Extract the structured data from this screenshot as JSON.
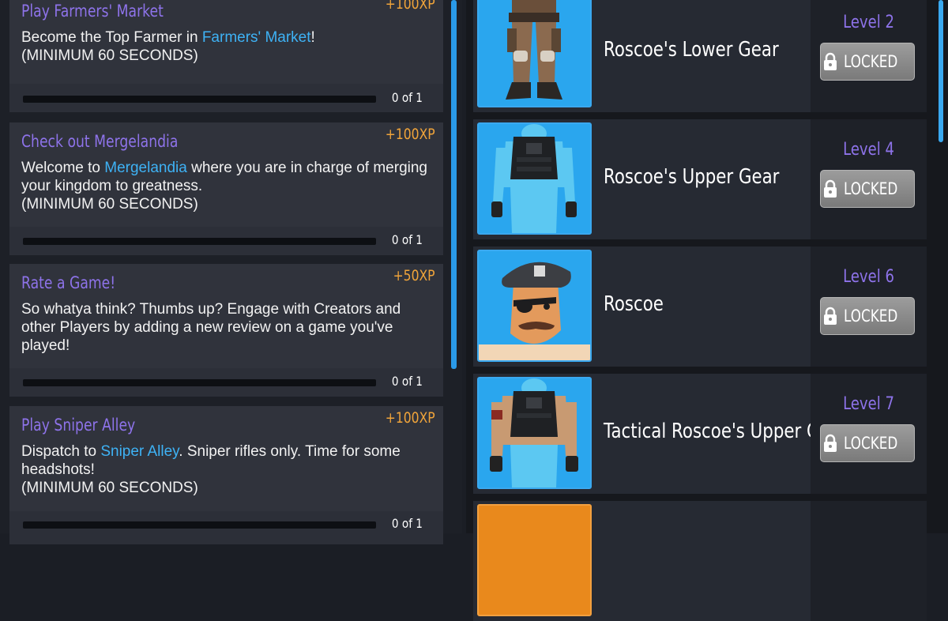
{
  "quests": [
    {
      "title": "Play Farmers' Market",
      "xp": "+100XP",
      "desc_parts": [
        "Become the Top Farmer in ",
        "Farmers' Market",
        "!"
      ],
      "desc_line2": "(MINIMUM 60 SECONDS)",
      "progress_text": "0 of 1",
      "progress": 0
    },
    {
      "title": "Check out Mergelandia",
      "xp": "+100XP",
      "desc_parts": [
        "Welcome to ",
        "Mergelandia",
        " where you are in charge of merging your kingdom to greatness."
      ],
      "desc_line2": "(MINIMUM 60 SECONDS)",
      "progress_text": "0 of 1",
      "progress": 0
    },
    {
      "title": "Rate a Game!",
      "xp": "+50XP",
      "desc_parts": [
        "So whatya think? Thumbs up? Engage with Creators and other Players by adding a new review on a game you've played!",
        "",
        ""
      ],
      "desc_line2": "",
      "progress_text": "0 of 1",
      "progress": 0
    },
    {
      "title": "Play Sniper Alley",
      "xp": "+100XP",
      "desc_parts": [
        "Dispatch to ",
        "Sniper Alley",
        ". Sniper rifles only. Time for some headshots!"
      ],
      "desc_line2": "(MINIMUM 60 SECONDS)",
      "progress_text": "0 of 1",
      "progress": 0
    }
  ],
  "rewards": [
    {
      "name": "Roscoe's Lower Gear",
      "level": "Level 2",
      "button": "LOCKED",
      "icon": "lower-gear-icon"
    },
    {
      "name": "Roscoe's Upper Gear",
      "level": "Level 4",
      "button": "LOCKED",
      "icon": "upper-gear-icon"
    },
    {
      "name": "Roscoe",
      "level": "Level 6",
      "button": "LOCKED",
      "icon": "roscoe-head-icon"
    },
    {
      "name": "Tactical Roscoe's Upper Gear",
      "level": "Level 7",
      "button": "LOCKED",
      "icon": "tactical-gear-icon"
    }
  ],
  "colors": {
    "accent_purple": "#8e73ea",
    "xp_orange": "#f0a43a",
    "link_blue": "#3eb2f5",
    "thumb_border": "#3aa9f0"
  }
}
